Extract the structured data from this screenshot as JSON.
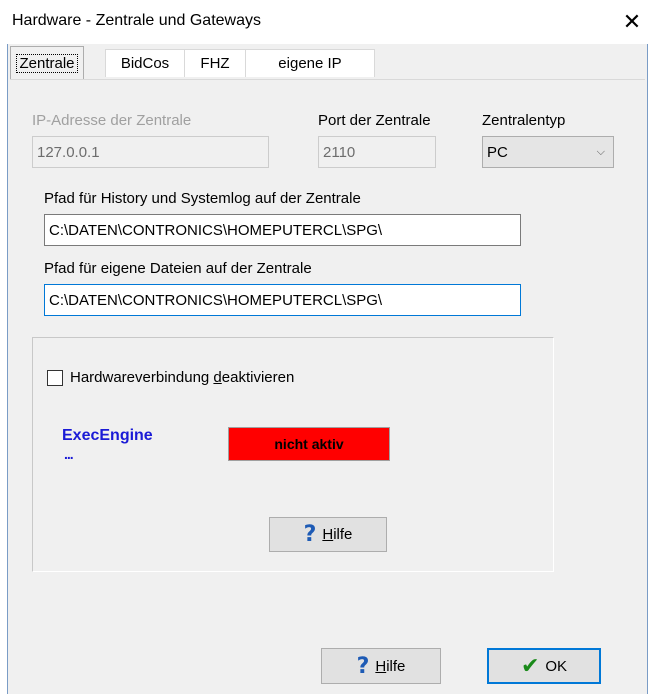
{
  "window": {
    "title": "Hardware  -  Zentrale und Gateways"
  },
  "tabs": [
    {
      "label": "Zentrale",
      "active": true
    },
    {
      "label": "BidCos",
      "active": false
    },
    {
      "label": "FHZ",
      "active": false
    },
    {
      "label": "eigene IP",
      "active": false
    }
  ],
  "zentrale": {
    "ip_label": "IP-Adresse der Zentrale",
    "ip_value": "127.0.0.1",
    "port_label": "Port der Zentrale",
    "port_value": "2110",
    "type_label": "Zentralentyp",
    "type_value": "PC",
    "history_label": "Pfad für History und Systemlog auf der Zentrale",
    "history_value": "C:\\DATEN\\CONTRONICS\\HOMEPUTERCL\\SPG\\",
    "files_label": "Pfad für eigene Dateien auf der Zentrale",
    "files_value": "C:\\DATEN\\CONTRONICS\\HOMEPUTERCL\\SPG\\"
  },
  "group": {
    "checkbox_pre": "Hardwareverbindung ",
    "checkbox_hotkey": "d",
    "checkbox_post": "eaktivieren",
    "exec_label": "ExecEngine",
    "exec_dots": "...",
    "status": "nicht aktiv",
    "status_color": "#ff0000",
    "help_hotkey": "H",
    "help_rest": "ilfe"
  },
  "footer": {
    "help_hotkey": "H",
    "help_rest": "ilfe",
    "ok_label": "OK"
  },
  "icons": {
    "help": "?",
    "ok": "✔",
    "close": "✕",
    "chevron": "⌵"
  },
  "colors": {
    "accent": "#0078d7",
    "exec_text": "#1a1ad6"
  }
}
